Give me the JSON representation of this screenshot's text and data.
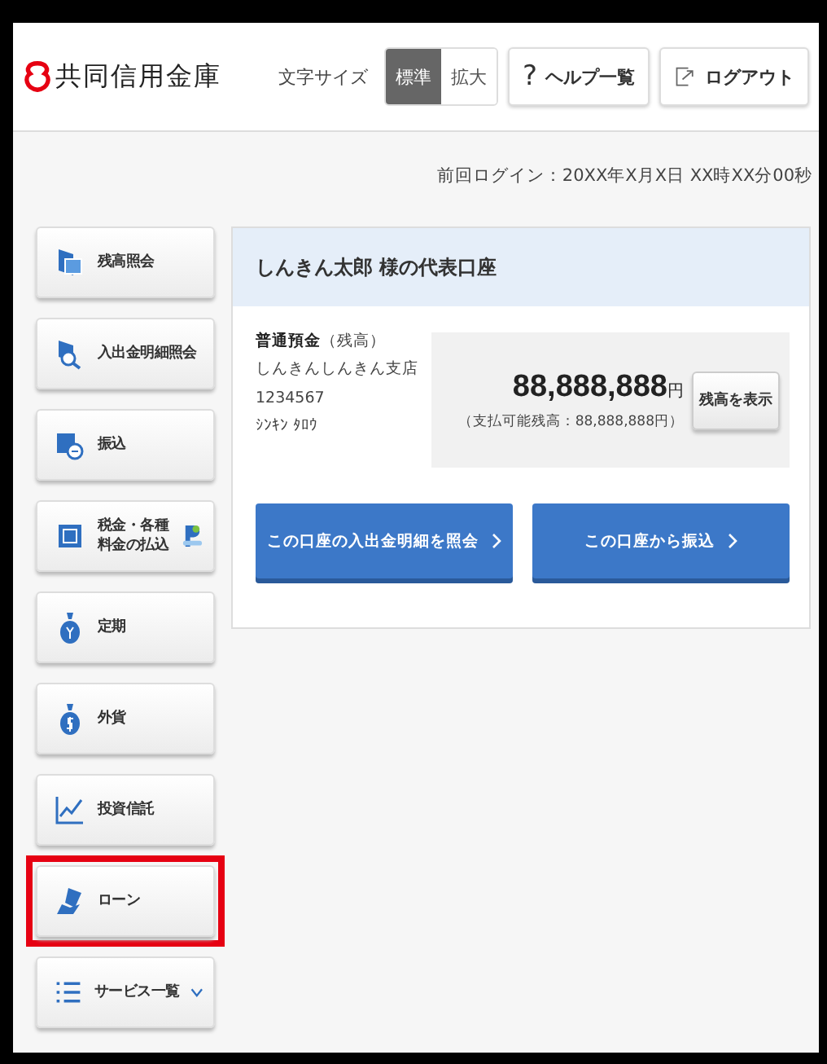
{
  "header": {
    "logo_text": "共同信用金庫",
    "font_size": {
      "label": "文字サイズ",
      "options": [
        {
          "label": "標準",
          "selected": true
        },
        {
          "label": "拡大",
          "selected": false
        }
      ]
    },
    "help_button": {
      "icon": "?",
      "label": "ヘルプ一覧"
    },
    "logout_button": {
      "label": "ログアウト"
    }
  },
  "last_login": "前回ログイン：20XX年X月X日 XX時XX分00秒",
  "sidebar": {
    "items": [
      {
        "kind": "balance",
        "lines": [
          "残高照会"
        ],
        "highlighted": false
      },
      {
        "kind": "statement",
        "lines": [
          "入出金明細照会"
        ],
        "highlighted": false
      },
      {
        "kind": "transfer",
        "lines": [
          "振込"
        ],
        "highlighted": false
      },
      {
        "kind": "tax",
        "lines": [
          "税金・各種",
          "料金の払込"
        ],
        "highlighted": false
      },
      {
        "kind": "deposit",
        "lines": [
          "定期"
        ],
        "highlighted": false
      },
      {
        "kind": "foreign",
        "lines": [
          "外貨"
        ],
        "highlighted": false
      },
      {
        "kind": "fund",
        "lines": [
          "投資信託"
        ],
        "highlighted": false
      },
      {
        "kind": "loan",
        "lines": [
          "ローン"
        ],
        "highlighted": true
      },
      {
        "kind": "services",
        "lines": [
          "サービス一覧"
        ],
        "highlighted": false,
        "expandable": true
      }
    ]
  },
  "account": {
    "title": "しんきん太郎 様の代表口座",
    "type": "普通預金",
    "type_note": "（残高）",
    "branch": "しんきんしんきん支店",
    "number": "1234567",
    "holder": "ｼﾝｷﾝ ﾀﾛｳ",
    "balance": "88,888,888",
    "unit": "円",
    "available": "（支払可能残高：88,888,888円）",
    "show_button": "残高を表示",
    "actions": [
      {
        "label": "この口座の入出金明細を照会"
      },
      {
        "label": "この口座から振込"
      }
    ]
  }
}
